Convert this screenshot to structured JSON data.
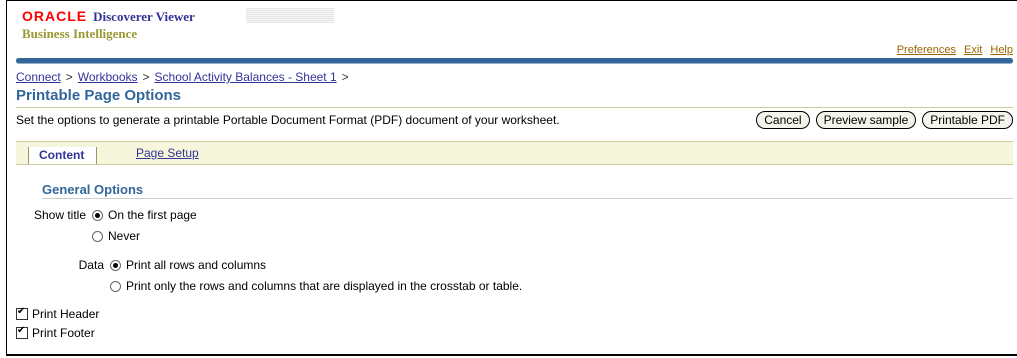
{
  "branding": {
    "oracle": "ORACLE",
    "product": "Discoverer Viewer",
    "subtitle": "Business Intelligence"
  },
  "global_links": {
    "preferences": "Preferences",
    "exit": "Exit",
    "help": "Help"
  },
  "breadcrumb": {
    "items": [
      "Connect",
      "Workbooks",
      "School Activity Balances - Sheet 1"
    ],
    "separator": ">"
  },
  "page": {
    "title": "Printable Page Options",
    "description": "Set the options to generate a printable Portable Document Format (PDF) document of your worksheet."
  },
  "actions": {
    "cancel": "Cancel",
    "preview_sample": "Preview sample",
    "printable_pdf": "Printable PDF"
  },
  "tabs": {
    "content": "Content",
    "page_setup": "Page Setup"
  },
  "general_options": {
    "title": "General Options",
    "show_title": {
      "label": "Show title",
      "options": [
        "On the first page",
        "Never"
      ],
      "selected": "On the first page"
    },
    "data": {
      "label": "Data",
      "options": [
        "Print all rows and columns",
        "Print only the rows and columns that are displayed in the crosstab or table."
      ],
      "selected": "Print all rows and columns"
    },
    "print_header": {
      "label": "Print Header",
      "checked": true
    },
    "print_footer": {
      "label": "Print Footer",
      "checked": true
    }
  },
  "colors": {
    "brand_red": "#ff0000",
    "brand_blue": "#333399",
    "brand_olive": "#999933",
    "title_blue": "#336699",
    "link_brown": "#996600",
    "tab_bg": "#f6f6dc"
  }
}
